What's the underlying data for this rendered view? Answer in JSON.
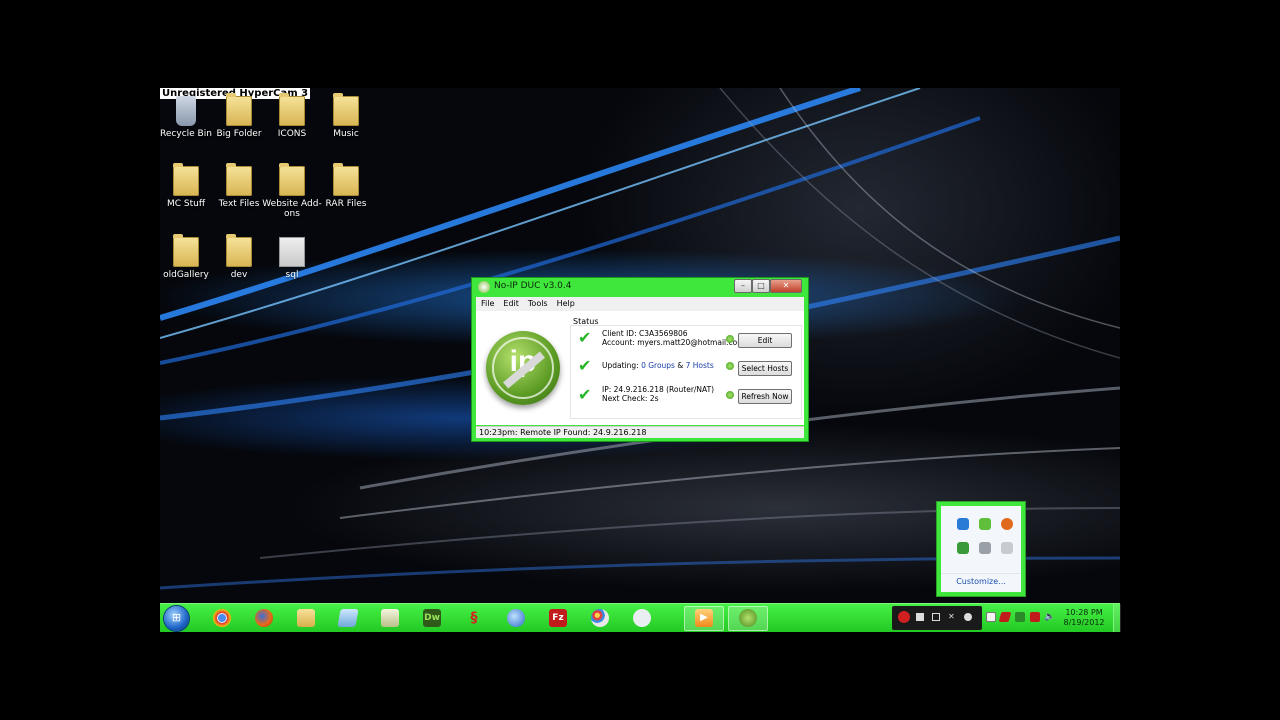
{
  "watermark": "Unregistered HyperCam 3",
  "desktop_icons": [
    {
      "label": "Recycle Bin",
      "icon": "recycle-bin-icon"
    },
    {
      "label": "Big Folder",
      "icon": "folder-icon"
    },
    {
      "label": "ICONS",
      "icon": "folder-icon"
    },
    {
      "label": "Music",
      "icon": "folder-icon"
    },
    {
      "label": "MC Stuff",
      "icon": "folder-icon"
    },
    {
      "label": "Text Files",
      "icon": "folder-icon"
    },
    {
      "label": "Website Add-ons",
      "icon": "folder-icon"
    },
    {
      "label": "RAR Files",
      "icon": "folder-icon"
    },
    {
      "label": "oldGallery",
      "icon": "folder-icon"
    },
    {
      "label": "dev",
      "icon": "folder-icon"
    },
    {
      "label": "sql",
      "icon": "sql-file-icon"
    }
  ],
  "window": {
    "title": "No-IP DUC v3.0.4",
    "menu": [
      "File",
      "Edit",
      "Tools",
      "Help"
    ],
    "status_label": "Status",
    "client_id_line": "Client ID: C3A3569806",
    "account_line": "Account: myers.matt20@hotmail.com",
    "updating_prefix": "Updating: ",
    "updating_groups": "0 Groups",
    "updating_and": " & ",
    "updating_hosts": "7 Hosts",
    "ip_line": "IP: 24.9.216.218 (Router/NAT)",
    "next_check_line": "Next Check: 2s",
    "edit_button": "Edit",
    "select_hosts_button": "Select Hosts",
    "refresh_button": "Refresh Now",
    "status_bar": "10:23pm: Remote IP Found: 24.9.216.218",
    "caption_close": "✕"
  },
  "tray_popup": {
    "customize": "Customize..."
  },
  "taskbar": {
    "apps": [
      "chrome-icon",
      "firefox-icon",
      "explorer-icon",
      "notepad-icon",
      "notepad-plus-icon",
      "dreamweaver-icon",
      "app-icon",
      "thunderbird-icon",
      "filezilla-icon",
      "paint-icon",
      "game-icon",
      "media-player-icon",
      "noip-icon"
    ],
    "dreamweaver_label": "Dw",
    "filezilla_label": "Fz",
    "time": "10:28 PM",
    "date": "8/19/2012"
  },
  "colors": {
    "accent": "#3fe63b",
    "check": "#26b526"
  }
}
